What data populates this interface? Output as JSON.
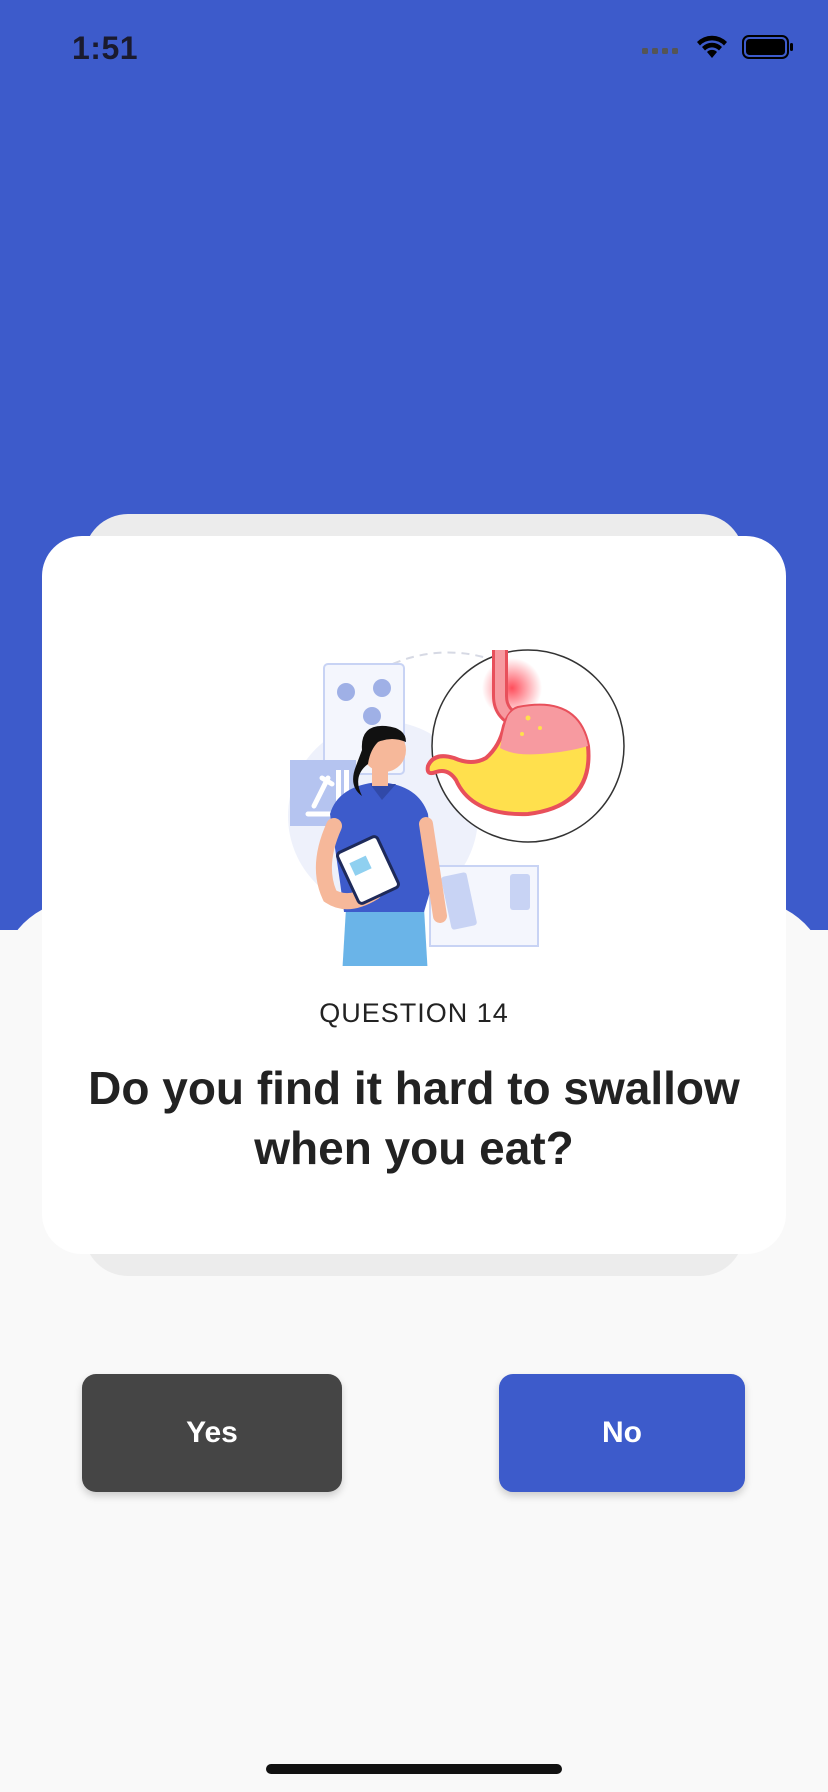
{
  "status_bar": {
    "time": "1:51",
    "icons": [
      "signal-icon",
      "wifi-icon",
      "battery-icon"
    ]
  },
  "card": {
    "illustration": "doctor-stomach-illustration",
    "question_number": "QUESTION 14",
    "question_text": "Do you find it hard to swallow when you eat?"
  },
  "answers": {
    "yes_label": "Yes",
    "no_label": "No"
  },
  "colors": {
    "primary": "#3d5bcb",
    "yes_button": "#454545",
    "background": "#f9f9f9"
  }
}
